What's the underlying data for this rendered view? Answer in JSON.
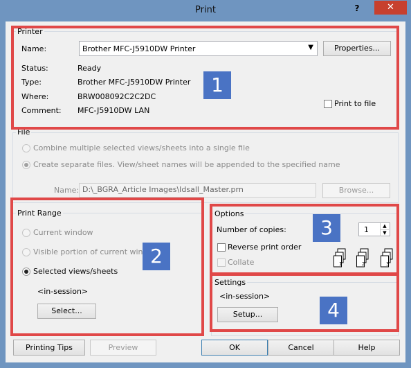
{
  "window": {
    "title": "Print",
    "help_glyph": "?",
    "close_glyph": "✕"
  },
  "printer": {
    "group_label": "Printer",
    "name_label": "Name:",
    "name_value": "Brother MFC-J5910DW Printer",
    "properties_label": "Properties...",
    "status_label": "Status:",
    "status_value": "Ready",
    "type_label": "Type:",
    "type_value": "Brother MFC-J5910DW Printer",
    "where_label": "Where:",
    "where_value": "BRW008092C2C2DC",
    "comment_label": "Comment:",
    "comment_value": "MFC-J5910DW LAN",
    "print_to_file_label": "Print to file"
  },
  "file": {
    "group_label": "File",
    "option_combine": "Combine multiple selected views/sheets into a single file",
    "option_separate": "Create separate files. View/sheet names will be appended to the specified name",
    "name_label": "Name:",
    "name_value": "D:\\_BGRA_Article Images\\Idsall_Master.prn",
    "browse_label": "Browse..."
  },
  "print_range": {
    "group_label": "Print Range",
    "option_current": "Current window",
    "option_visible": "Visible portion of current window",
    "option_selected": "Selected views/sheets",
    "session_text": "<in-session>",
    "select_label": "Select..."
  },
  "options": {
    "group_label": "Options",
    "copies_label": "Number of copies:",
    "copies_value": "1",
    "reverse_label": "Reverse print order",
    "collate_label": "Collate"
  },
  "settings": {
    "group_label": "Settings",
    "session_text": "<in-session>",
    "setup_label": "Setup..."
  },
  "annotations": {
    "badge_1": "1",
    "badge_2": "2",
    "badge_3": "3",
    "badge_4": "4"
  },
  "footer": {
    "printing_tips_label": "Printing Tips",
    "preview_label": "Preview",
    "ok_label": "OK",
    "cancel_label": "Cancel",
    "help_label": "Help"
  },
  "colors": {
    "annotation_red": "#e04848",
    "badge_blue": "#4a73c4",
    "close_red": "#c7402e",
    "frame_blue": "#6f95c0"
  }
}
